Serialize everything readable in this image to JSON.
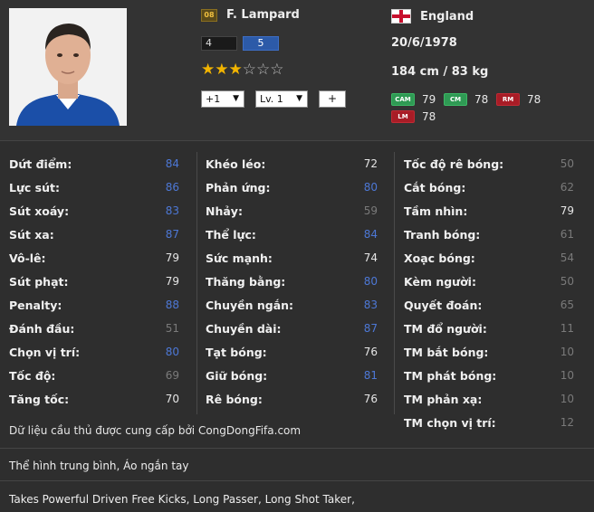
{
  "player": {
    "season_badge": "08",
    "name": "F. Lampard",
    "skill_moves": "4",
    "weak_foot": "5",
    "stars_filled": 3,
    "stars_total": 6,
    "enhance_select": "+1",
    "level_select": "Lv. 1",
    "add_button": "+",
    "nation": "England",
    "birth_date": "20/6/1978",
    "height_weight": "184 cm / 83 kg",
    "positions": [
      {
        "code": "CAM",
        "rating": "79",
        "group": "mid"
      },
      {
        "code": "CM",
        "rating": "78",
        "group": "mid"
      },
      {
        "code": "RM",
        "rating": "78",
        "group": "fwd"
      },
      {
        "code": "LM",
        "rating": "78",
        "group": "fwd"
      }
    ]
  },
  "stats": {
    "col1": [
      {
        "label": "Dứt điểm:",
        "value": "84",
        "tone": "high"
      },
      {
        "label": "Lực sút:",
        "value": "86",
        "tone": "high"
      },
      {
        "label": "Sút xoáy:",
        "value": "83",
        "tone": "high"
      },
      {
        "label": "Sút xa:",
        "value": "87",
        "tone": "high"
      },
      {
        "label": "Vô-lê:",
        "value": "79",
        "tone": "mid"
      },
      {
        "label": "Sút phạt:",
        "value": "79",
        "tone": "mid"
      },
      {
        "label": "Penalty:",
        "value": "88",
        "tone": "high"
      },
      {
        "label": "Đánh đầu:",
        "value": "51",
        "tone": "low"
      },
      {
        "label": "Chọn vị trí:",
        "value": "80",
        "tone": "high"
      },
      {
        "label": "Tốc độ:",
        "value": "69",
        "tone": "low"
      },
      {
        "label": "Tăng tốc:",
        "value": "70",
        "tone": "mid"
      }
    ],
    "col2": [
      {
        "label": "Khéo léo:",
        "value": "72",
        "tone": "mid"
      },
      {
        "label": "Phản ứng:",
        "value": "80",
        "tone": "high"
      },
      {
        "label": "Nhảy:",
        "value": "59",
        "tone": "low"
      },
      {
        "label": "Thể lực:",
        "value": "84",
        "tone": "high"
      },
      {
        "label": "Sức mạnh:",
        "value": "74",
        "tone": "mid"
      },
      {
        "label": "Thăng bằng:",
        "value": "80",
        "tone": "high"
      },
      {
        "label": "Chuyền ngắn:",
        "value": "83",
        "tone": "high"
      },
      {
        "label": "Chuyền dài:",
        "value": "87",
        "tone": "high"
      },
      {
        "label": "Tạt bóng:",
        "value": "76",
        "tone": "mid"
      },
      {
        "label": "Giữ bóng:",
        "value": "81",
        "tone": "high"
      },
      {
        "label": "Rê bóng:",
        "value": "76",
        "tone": "mid"
      }
    ],
    "col3": [
      {
        "label": "Tốc độ rê bóng:",
        "value": "50",
        "tone": "low"
      },
      {
        "label": "Cắt bóng:",
        "value": "62",
        "tone": "low"
      },
      {
        "label": "Tầm nhìn:",
        "value": "79",
        "tone": "mid"
      },
      {
        "label": "Tranh bóng:",
        "value": "61",
        "tone": "low"
      },
      {
        "label": "Xoạc bóng:",
        "value": "54",
        "tone": "low"
      },
      {
        "label": "Kèm người:",
        "value": "50",
        "tone": "low"
      },
      {
        "label": "Quyết đoán:",
        "value": "65",
        "tone": "low"
      },
      {
        "label": "TM đổ người:",
        "value": "11",
        "tone": "low"
      },
      {
        "label": "TM bắt bóng:",
        "value": "10",
        "tone": "low"
      },
      {
        "label": "TM phát bóng:",
        "value": "10",
        "tone": "low"
      },
      {
        "label": "TM phản xạ:",
        "value": "10",
        "tone": "low"
      },
      {
        "label": "TM chọn vị trí:",
        "value": "12",
        "tone": "low"
      }
    ]
  },
  "footer": {
    "source_text": "Dữ liệu cầu thủ được cung cấp bởi CongDongFifa.com",
    "body_type": "Thể hình trung bình, Áo ngắn tay",
    "traits": "Takes Powerful Driven Free Kicks, Long Passer, Long Shot Taker,"
  },
  "colors": {
    "high": "#4d78d6",
    "mid": "#e6e6e6",
    "low": "#7a7a7a"
  }
}
